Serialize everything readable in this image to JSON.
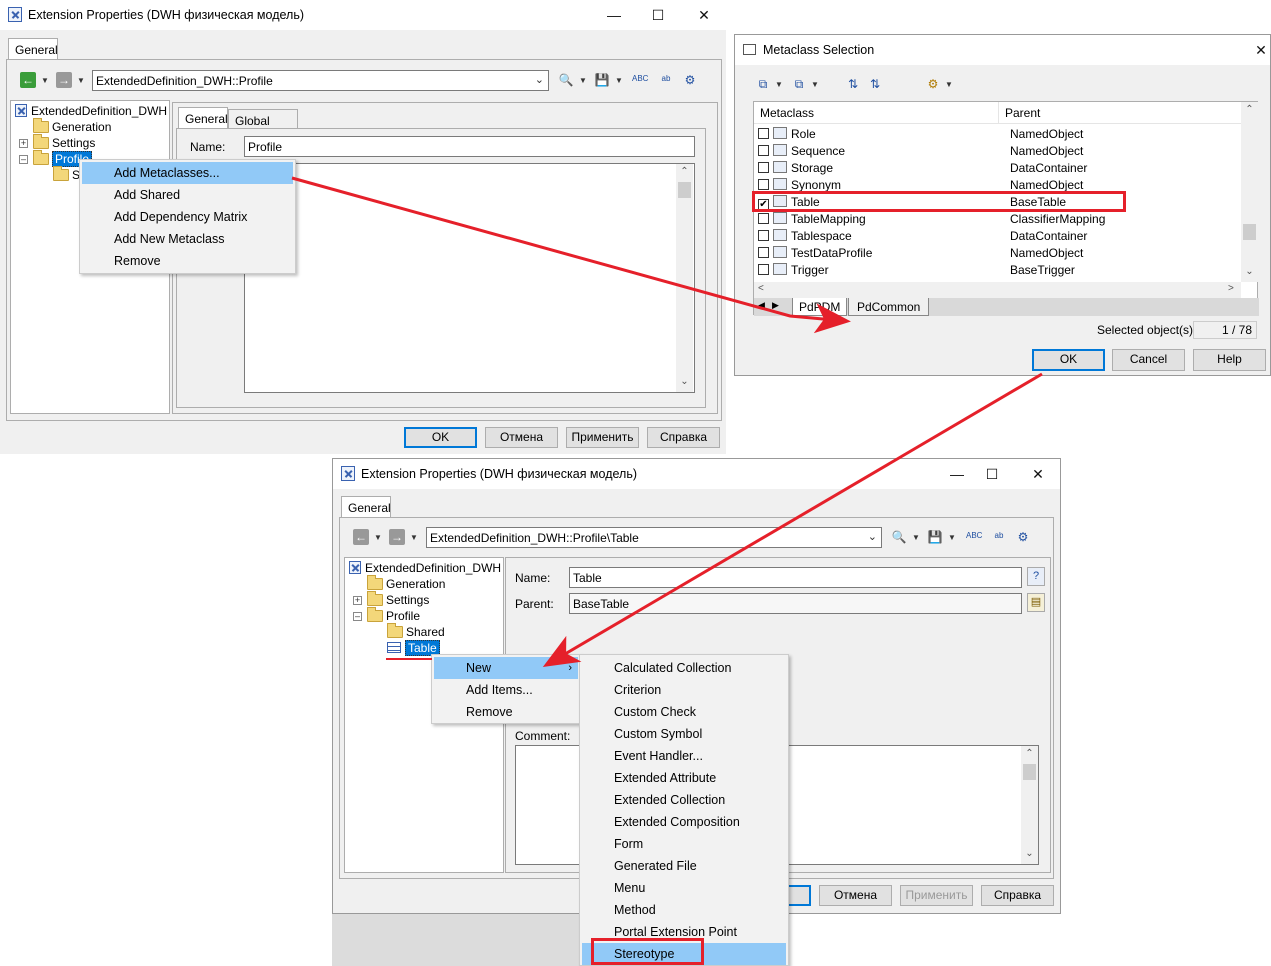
{
  "win1": {
    "title": "Extension Properties (DWH физическая модель)",
    "tab_general": "General",
    "path": "ExtendedDefinition_DWH::Profile",
    "tree": {
      "root": "ExtendedDefinition_DWH",
      "generation": "Generation",
      "settings": "Settings",
      "profile": "Profile",
      "shared_partial": "S"
    },
    "inner_tabs": [
      "General",
      "Global Script"
    ],
    "name_label": "Name:",
    "name_value": "Profile",
    "context_menu": [
      "Add Metaclasses...",
      "Add Shared",
      "Add Dependency Matrix",
      "Add New Metaclass",
      "Remove"
    ],
    "buttons": {
      "ok": "OK",
      "cancel": "Отмена",
      "apply": "Применить",
      "help": "Справка"
    }
  },
  "win2": {
    "title": "Metaclass Selection",
    "columns": [
      "Metaclass",
      "Parent"
    ],
    "rows": [
      {
        "name": "Role",
        "parent": "NamedObject",
        "checked": false
      },
      {
        "name": "Sequence",
        "parent": "NamedObject",
        "checked": false
      },
      {
        "name": "Storage",
        "parent": "DataContainer",
        "checked": false
      },
      {
        "name": "Synonym",
        "parent": "NamedObject",
        "checked": false
      },
      {
        "name": "Table",
        "parent": "BaseTable",
        "checked": true
      },
      {
        "name": "TableMapping",
        "parent": "ClassifierMapping",
        "checked": false
      },
      {
        "name": "Tablespace",
        "parent": "DataContainer",
        "checked": false
      },
      {
        "name": "TestDataProfile",
        "parent": "NamedObject",
        "checked": false
      },
      {
        "name": "Trigger",
        "parent": "BaseTrigger",
        "checked": false
      }
    ],
    "tabs": [
      "PdPDM",
      "PdCommon"
    ],
    "selected_label": "Selected object(s):",
    "selected_value": "1 / 78",
    "buttons": {
      "ok": "OK",
      "cancel": "Cancel",
      "help": "Help"
    }
  },
  "win3": {
    "title": "Extension Properties (DWH физическая модель)",
    "tab_general": "General",
    "path": "ExtendedDefinition_DWH::Profile\\Table",
    "tree": {
      "root": "ExtendedDefinition_DWH",
      "generation": "Generation",
      "settings": "Settings",
      "profile": "Profile",
      "shared": "Shared",
      "table": "Table"
    },
    "name_label": "Name:",
    "name_value": "Table",
    "parent_label": "Parent:",
    "parent_value": "BaseTable",
    "comment_label": "Comment:",
    "context_menu": [
      "New",
      "Add Items...",
      "Remove"
    ],
    "submenu": [
      "Calculated Collection",
      "Criterion",
      "Custom Check",
      "Custom Symbol",
      "Event Handler...",
      "Extended Attribute",
      "Extended Collection",
      "Extended Composition",
      "Form",
      "Generated File",
      "Menu",
      "Method",
      "Portal Extension Point",
      "Stereotype"
    ],
    "buttons": {
      "cancel": "Отмена",
      "apply": "Применить",
      "help": "Справка"
    }
  },
  "icons": {
    "toolbar": [
      "back-arrow-icon",
      "forward-arrow-icon",
      "find-icon",
      "save-icon",
      "spell-check-icon",
      "replace-icon",
      "properties-icon"
    ],
    "window": [
      "minimize-icon",
      "maximize-icon",
      "close-icon"
    ]
  },
  "colors": {
    "highlight": "#91c9f7",
    "selection": "#0078d7",
    "annotation": "#e5202a",
    "default_button": "#0078d7"
  }
}
